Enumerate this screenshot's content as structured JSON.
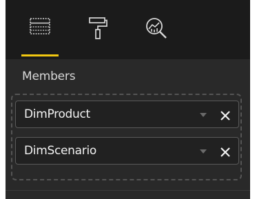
{
  "colors": {
    "panel_bg": "#292929",
    "toolbar_bg": "#1b1b1b",
    "accent": "#f2c811",
    "text": "#f2f2f2",
    "muted": "#6a6a6a"
  },
  "toolbar": {
    "tabs": [
      {
        "icon": "fields-icon",
        "active": true
      },
      {
        "icon": "format-paint-roller-icon",
        "active": false
      },
      {
        "icon": "analytics-magnifier-icon",
        "active": false
      }
    ]
  },
  "section": {
    "title": "Members"
  },
  "members": [
    {
      "label": "DimProduct"
    },
    {
      "label": "DimScenario"
    }
  ]
}
